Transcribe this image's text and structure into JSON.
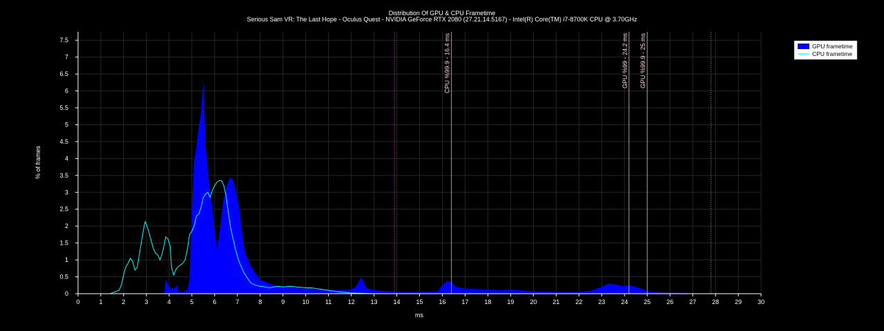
{
  "chart_data": {
    "type": "area",
    "title": "Distribution Of GPU & CPU Frametime",
    "subtitle": "Serious Sam VR: The Last Hope - Oculus Quest - NVIDIA GeForce RTX 2080 (27.21.14.5167) - Intel(R) Core(TM) i7-8700K CPU @ 3.70GHz",
    "xlabel": "ms",
    "ylabel": "% of frames",
    "xlim": [
      0,
      30
    ],
    "ylim": [
      0,
      7.75
    ],
    "x_ticks": [
      "0",
      "1",
      "2",
      "3",
      "4",
      "5",
      "6",
      "7",
      "8",
      "9",
      "10",
      "11",
      "12",
      "13",
      "14",
      "15",
      "16",
      "17",
      "18",
      "19",
      "20",
      "21",
      "22",
      "23",
      "24",
      "25",
      "26",
      "27",
      "28",
      "29",
      "30"
    ],
    "y_ticks": [
      "0",
      "0.5",
      "1",
      "1.5",
      "2",
      "2.5",
      "3",
      "3.5",
      "4",
      "4.5",
      "5",
      "5.5",
      "6",
      "6.5",
      "7",
      "7.5"
    ],
    "grid": true,
    "legend_position": "top-right",
    "series": [
      {
        "name": "GPU frametime",
        "style": "filled area",
        "color": "#0000ff",
        "points": [
          [
            3.8,
            0
          ],
          [
            3.85,
            0.4
          ],
          [
            4.0,
            0.22
          ],
          [
            4.1,
            0.15
          ],
          [
            4.2,
            0.15
          ],
          [
            4.3,
            0.2
          ],
          [
            4.35,
            0.25
          ],
          [
            4.4,
            0.06
          ],
          [
            4.6,
            0.05
          ],
          [
            4.8,
            0.1
          ],
          [
            4.9,
            0.4
          ],
          [
            5.0,
            2.2
          ],
          [
            5.1,
            3.9
          ],
          [
            5.2,
            4.3
          ],
          [
            5.3,
            4.9
          ],
          [
            5.4,
            5.3
          ],
          [
            5.5,
            6.2
          ],
          [
            5.55,
            5.3
          ],
          [
            5.6,
            4.3
          ],
          [
            5.7,
            3.6
          ],
          [
            5.8,
            3.0
          ],
          [
            5.9,
            2.5
          ],
          [
            6.0,
            1.8
          ],
          [
            6.1,
            1.3
          ],
          [
            6.2,
            1.7
          ],
          [
            6.3,
            2.3
          ],
          [
            6.4,
            2.8
          ],
          [
            6.5,
            3.1
          ],
          [
            6.6,
            3.3
          ],
          [
            6.7,
            3.45
          ],
          [
            6.8,
            3.35
          ],
          [
            6.9,
            3.1
          ],
          [
            7.0,
            2.8
          ],
          [
            7.1,
            2.4
          ],
          [
            7.2,
            1.8
          ],
          [
            7.3,
            1.3
          ],
          [
            7.4,
            1.1
          ],
          [
            7.5,
            0.95
          ],
          [
            7.6,
            0.8
          ],
          [
            7.7,
            0.7
          ],
          [
            7.8,
            0.6
          ],
          [
            7.9,
            0.5
          ],
          [
            8.0,
            0.42
          ],
          [
            8.2,
            0.35
          ],
          [
            8.4,
            0.3
          ],
          [
            8.6,
            0.25
          ],
          [
            8.8,
            0.2
          ],
          [
            9.0,
            0.2
          ],
          [
            9.3,
            0.17
          ],
          [
            9.6,
            0.18
          ],
          [
            10.0,
            0.14
          ],
          [
            10.5,
            0.12
          ],
          [
            11.0,
            0.1
          ],
          [
            11.5,
            0.1
          ],
          [
            12.0,
            0.12
          ],
          [
            12.2,
            0.2
          ],
          [
            12.35,
            0.38
          ],
          [
            12.45,
            0.48
          ],
          [
            12.55,
            0.3
          ],
          [
            12.7,
            0.15
          ],
          [
            13.0,
            0.1
          ],
          [
            14.0,
            0.05
          ],
          [
            15.0,
            0.05
          ],
          [
            15.8,
            0.06
          ],
          [
            16.0,
            0.25
          ],
          [
            16.2,
            0.37
          ],
          [
            16.4,
            0.33
          ],
          [
            16.6,
            0.2
          ],
          [
            16.8,
            0.17
          ],
          [
            17.0,
            0.15
          ],
          [
            17.5,
            0.13
          ],
          [
            18.0,
            0.12
          ],
          [
            18.5,
            0.1
          ],
          [
            19.0,
            0.12
          ],
          [
            19.5,
            0.09
          ],
          [
            20.0,
            0.07
          ],
          [
            21.0,
            0.05
          ],
          [
            22.0,
            0.05
          ],
          [
            22.5,
            0.08
          ],
          [
            23.0,
            0.2
          ],
          [
            23.3,
            0.29
          ],
          [
            23.6,
            0.27
          ],
          [
            23.9,
            0.22
          ],
          [
            24.2,
            0.25
          ],
          [
            24.5,
            0.2
          ],
          [
            24.8,
            0.13
          ],
          [
            25.0,
            0.06
          ],
          [
            25.5,
            0.04
          ],
          [
            26.5,
            0.02
          ],
          [
            27.0,
            0
          ]
        ]
      },
      {
        "name": "CPU frametime",
        "style": "line",
        "color": "#00ffff",
        "points": [
          [
            1.4,
            0
          ],
          [
            1.5,
            0.02
          ],
          [
            1.6,
            0.05
          ],
          [
            1.8,
            0.1
          ],
          [
            1.9,
            0.25
          ],
          [
            2.0,
            0.55
          ],
          [
            2.1,
            0.8
          ],
          [
            2.2,
            0.9
          ],
          [
            2.3,
            1.05
          ],
          [
            2.4,
            0.95
          ],
          [
            2.5,
            0.7
          ],
          [
            2.6,
            0.78
          ],
          [
            2.7,
            1.2
          ],
          [
            2.8,
            1.6
          ],
          [
            2.9,
            2.0
          ],
          [
            2.95,
            2.13
          ],
          [
            3.0,
            2.05
          ],
          [
            3.1,
            1.85
          ],
          [
            3.2,
            1.6
          ],
          [
            3.3,
            1.35
          ],
          [
            3.4,
            1.2
          ],
          [
            3.5,
            1.15
          ],
          [
            3.6,
            1.0
          ],
          [
            3.7,
            1.2
          ],
          [
            3.8,
            1.5
          ],
          [
            3.85,
            1.68
          ],
          [
            3.95,
            1.62
          ],
          [
            4.05,
            1.4
          ],
          [
            4.1,
            0.8
          ],
          [
            4.2,
            0.55
          ],
          [
            4.3,
            0.72
          ],
          [
            4.4,
            0.8
          ],
          [
            4.5,
            0.85
          ],
          [
            4.6,
            0.9
          ],
          [
            4.7,
            1.0
          ],
          [
            4.8,
            1.3
          ],
          [
            4.9,
            1.75
          ],
          [
            5.0,
            1.85
          ],
          [
            5.1,
            2.0
          ],
          [
            5.2,
            2.3
          ],
          [
            5.3,
            2.35
          ],
          [
            5.4,
            2.55
          ],
          [
            5.5,
            2.85
          ],
          [
            5.6,
            2.95
          ],
          [
            5.7,
            3.0
          ],
          [
            5.8,
            2.85
          ],
          [
            5.9,
            3.05
          ],
          [
            6.0,
            3.2
          ],
          [
            6.1,
            3.3
          ],
          [
            6.2,
            3.35
          ],
          [
            6.3,
            3.35
          ],
          [
            6.4,
            3.2
          ],
          [
            6.5,
            2.9
          ],
          [
            6.6,
            2.4
          ],
          [
            6.7,
            1.95
          ],
          [
            6.8,
            1.65
          ],
          [
            6.9,
            1.35
          ],
          [
            7.0,
            1.1
          ],
          [
            7.1,
            0.9
          ],
          [
            7.2,
            0.75
          ],
          [
            7.3,
            0.6
          ],
          [
            7.4,
            0.5
          ],
          [
            7.5,
            0.4
          ],
          [
            7.6,
            0.32
          ],
          [
            7.8,
            0.25
          ],
          [
            8.0,
            0.22
          ],
          [
            8.2,
            0.2
          ],
          [
            8.4,
            0.18
          ],
          [
            8.6,
            0.2
          ],
          [
            8.8,
            0.22
          ],
          [
            9.0,
            0.2
          ],
          [
            9.3,
            0.22
          ],
          [
            9.6,
            0.2
          ],
          [
            10.0,
            0.18
          ],
          [
            10.3,
            0.17
          ],
          [
            10.6,
            0.14
          ],
          [
            11.0,
            0.1
          ],
          [
            11.3,
            0.07
          ],
          [
            11.7,
            0.04
          ],
          [
            12.0,
            0.02
          ],
          [
            12.5,
            0.01
          ],
          [
            13.0,
            0
          ]
        ]
      }
    ],
    "reference_lines": [
      {
        "x": 13.9,
        "color": "#ff00ff",
        "style": "dotted",
        "label": ""
      },
      {
        "x": 16.4,
        "color": "#a0a0a0",
        "style": "solid",
        "label": "CPU %99.9 - 16.4 ms"
      },
      {
        "x": 24.2,
        "color": "#a0a0a0",
        "style": "solid",
        "label": "GPU %99 - 24.2 ms"
      },
      {
        "x": 25.0,
        "color": "#a0a0a0",
        "style": "solid",
        "label": "GPU %99.9 - 25 ms"
      },
      {
        "x": 27.8,
        "color": "#ff00ff",
        "style": "dotted",
        "label": ""
      }
    ]
  }
}
